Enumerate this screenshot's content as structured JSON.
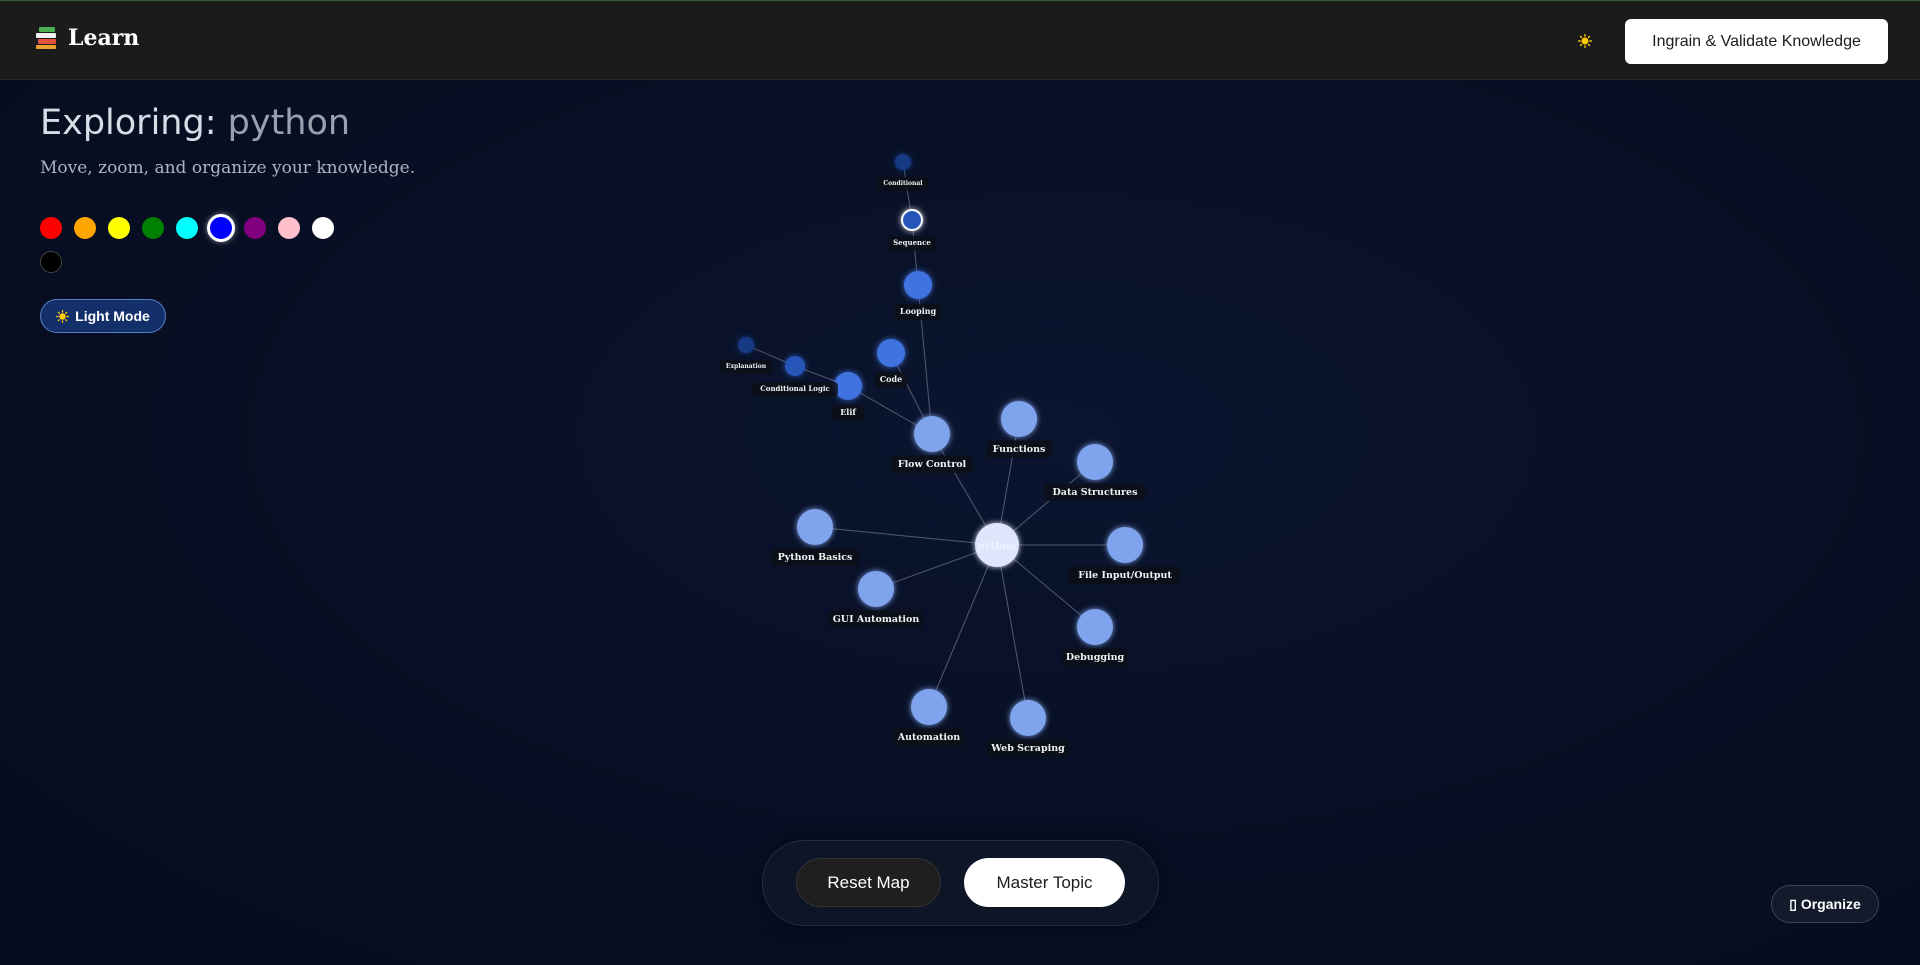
{
  "header": {
    "brand_title": "Learn",
    "brand_icon": "books-icon",
    "theme_icon": "sun-icon",
    "cta_label": "Ingrain & Validate Knowledge"
  },
  "intro": {
    "title_prefix": "Exploring:",
    "topic": "python",
    "subtitle": "Move, zoom, and organize your knowledge."
  },
  "palette": {
    "colors": [
      "#ff0000",
      "#ffa500",
      "#ffff00",
      "#008000",
      "#00ffff",
      "#0000ff",
      "#800080",
      "#ffc0cb",
      "#ffffff",
      "#000000"
    ],
    "selected": "#0000ff"
  },
  "mode_toggle": {
    "label": "Light Mode",
    "icon": "sun-icon"
  },
  "graph": {
    "root": "python",
    "nodes": [
      "python",
      "Flow Control",
      "Functions",
      "Data Structures",
      "File Input/Output",
      "Debugging",
      "Web Scraping",
      "Automation",
      "GUI Automation",
      "Python Basics",
      "Elif",
      "Code",
      "Looping",
      "Sequence",
      "Conditional",
      "Conditional Logic",
      "Explanation"
    ],
    "edges": [
      [
        "python",
        "Flow Control"
      ],
      [
        "python",
        "Functions"
      ],
      [
        "python",
        "Data Structures"
      ],
      [
        "python",
        "File Input/Output"
      ],
      [
        "python",
        "Debugging"
      ],
      [
        "python",
        "Web Scraping"
      ],
      [
        "python",
        "Automation"
      ],
      [
        "python",
        "GUI Automation"
      ],
      [
        "python",
        "Python Basics"
      ],
      [
        "Flow Control",
        "Elif"
      ],
      [
        "Flow Control",
        "Code"
      ],
      [
        "Flow Control",
        "Looping"
      ],
      [
        "Looping",
        "Sequence"
      ],
      [
        "Sequence",
        "Conditional"
      ],
      [
        "Elif",
        "Conditional Logic"
      ],
      [
        "Conditional Logic",
        "Explanation"
      ]
    ],
    "colors": {
      "root": "#dde6fb",
      "level1": "#7fa3ec",
      "level2": "#3f73e0",
      "level3": "#2554b8",
      "level4": "#173a84",
      "edge": "#6b7386"
    }
  },
  "controls": {
    "reset_label": "Reset Map",
    "master_label": "Master Topic"
  },
  "organize": {
    "label": "▯ Organize"
  }
}
